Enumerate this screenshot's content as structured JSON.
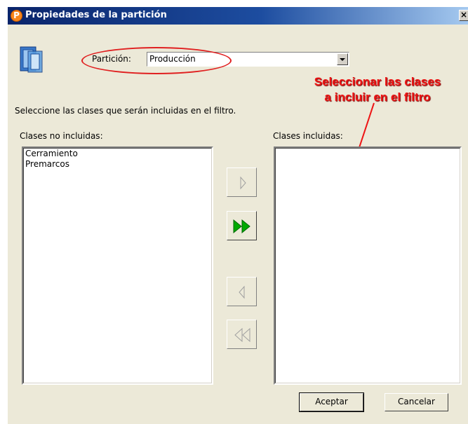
{
  "window": {
    "title": "Propiedades de la partición",
    "title_icon_letter": "P",
    "close_label": "×"
  },
  "partition": {
    "label": "Partición:",
    "value": "Producción"
  },
  "instructions": "Seleccione las clases que serán incluidas en el filtro.",
  "annotation": {
    "line1": "Seleccionar las clases",
    "line2": "a incluir en el filtro",
    "color": "#ee1515"
  },
  "excluded_list": {
    "label": "Clases no incluidas:",
    "items": [
      "Cerramiento",
      "Premarcos"
    ]
  },
  "included_list": {
    "label": "Clases incluidas:",
    "items": []
  },
  "move_buttons": {
    "add_selected": {
      "icon": "arrow-right-icon",
      "enabled": false
    },
    "add_all": {
      "icon": "double-arrow-right-icon",
      "enabled": true,
      "color": "#00aa00"
    },
    "remove_selected": {
      "icon": "arrow-left-icon",
      "enabled": false
    },
    "remove_all": {
      "icon": "double-arrow-left-icon",
      "enabled": false
    }
  },
  "buttons": {
    "accept_label": "Aceptar",
    "cancel_label": "Cancelar"
  }
}
